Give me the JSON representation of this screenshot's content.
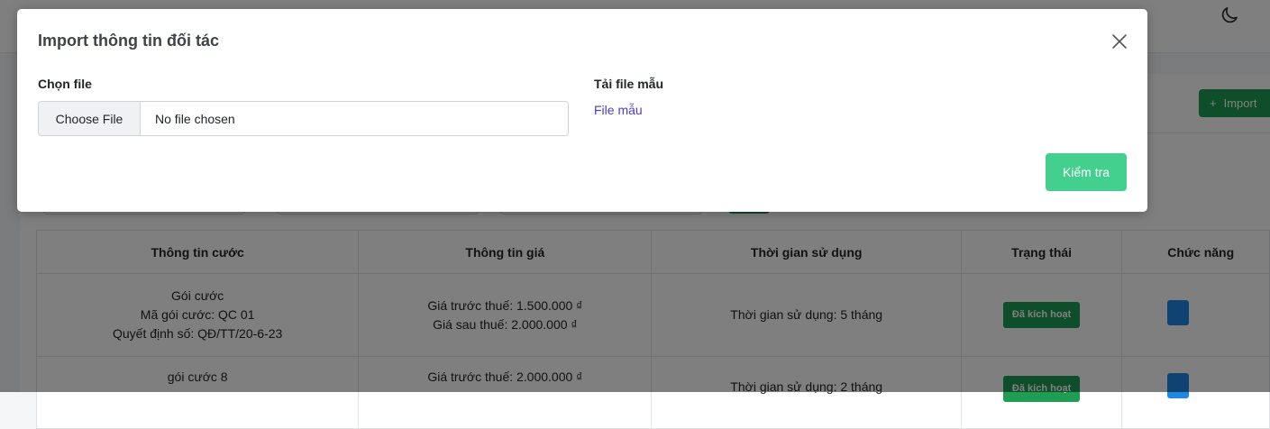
{
  "page": {
    "import_button_label": "Import",
    "table": {
      "headers": [
        "Thông tin cước",
        "Thông tin giá",
        "Thời gian sử dụng",
        "Trạng thái",
        "Chức năng"
      ],
      "rows": [
        {
          "package_name": "Gói cước",
          "package_code": "Mã gói cước: QC 01",
          "decision_no": "Quyết định số: QĐ/TT/20-6-23",
          "price_before_tax": "Giá trước thuế: 1.500.000 ₫",
          "price_after_tax": "Giá sau thuế: 2.000.000 ₫",
          "usage_time": "Thời gian sử dụng: 5 tháng",
          "status": "Đã kích hoạt"
        },
        {
          "package_name": "gói cước 8",
          "price_before_tax": "Giá trước thuế: 2.000.000 ₫",
          "usage_time": "Thời gian sử dụng: 2 tháng",
          "status": "Đã kích hoạt"
        }
      ]
    }
  },
  "modal": {
    "title": "Import thông tin đối tác",
    "choose_file_label": "Chọn file",
    "choose_file_button": "Choose File",
    "file_status": "No file chosen",
    "template_label": "Tải file mẫu",
    "template_link": "File mẫu",
    "check_button": "Kiểm tra"
  },
  "colors": {
    "accent_green": "#43d08f",
    "badge_green": "#1f9d55",
    "link_purple": "#4e3cc7"
  }
}
